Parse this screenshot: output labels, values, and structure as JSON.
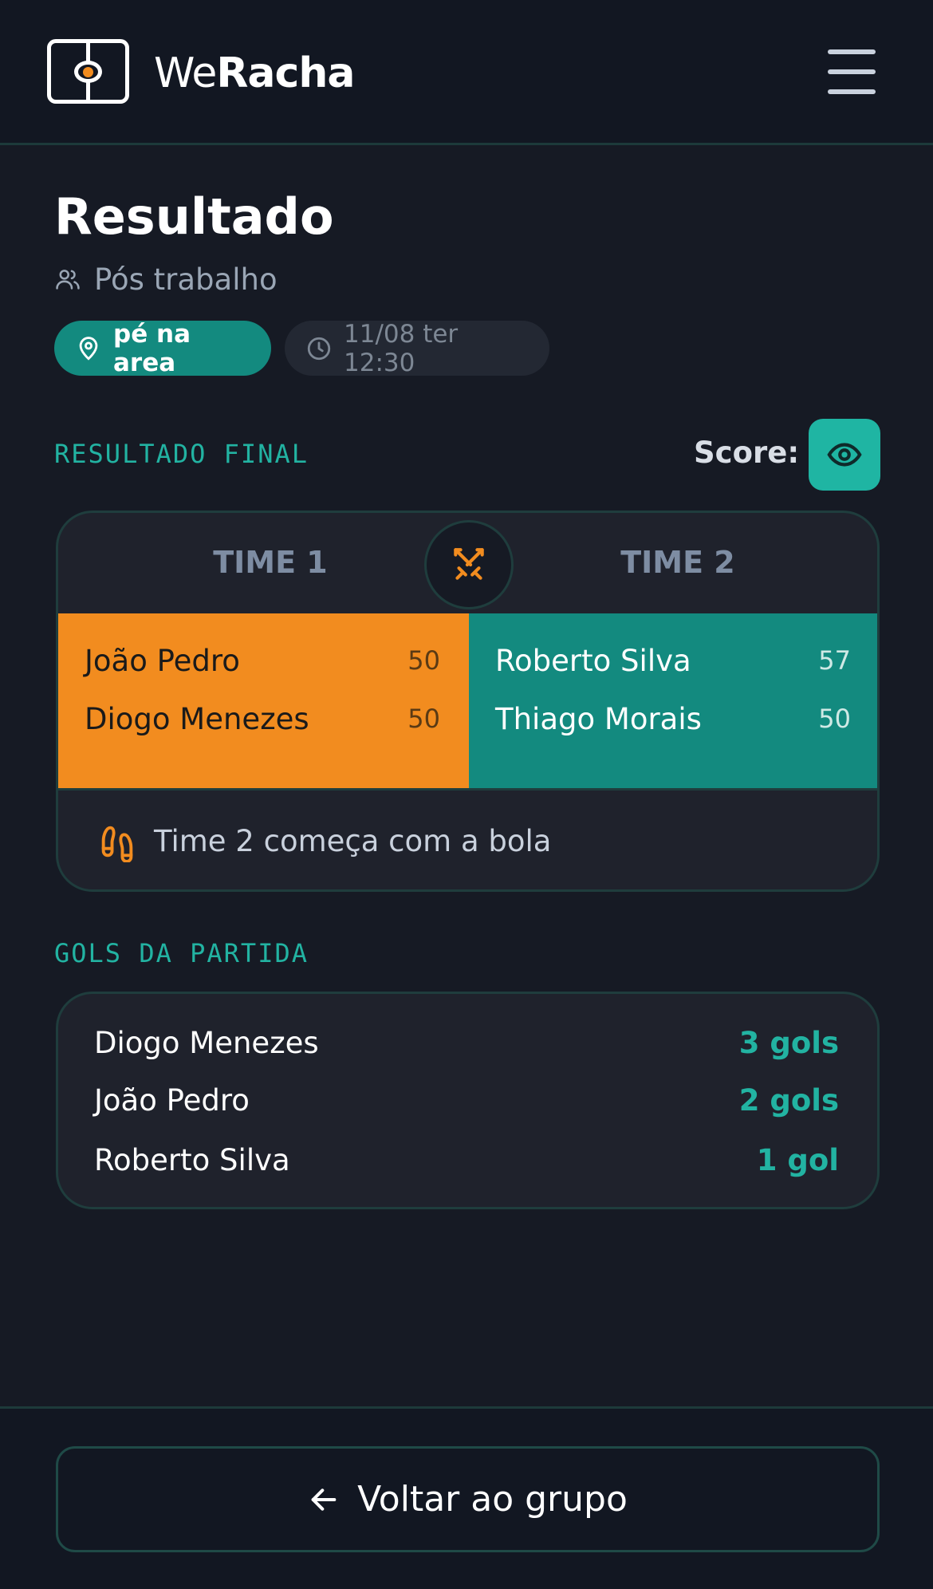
{
  "header": {
    "brand_light": "We",
    "brand_bold": "Racha"
  },
  "page": {
    "title": "Resultado",
    "group_name": "Pós trabalho",
    "location": "pé na area",
    "datetime": "11/08 ter 12:30"
  },
  "result": {
    "section_label": "RESULTADO FINAL",
    "score_label": "Score:",
    "team1": {
      "name": "TIME 1",
      "players": [
        {
          "name": "João Pedro",
          "score": "50"
        },
        {
          "name": "Diogo Menezes",
          "score": "50"
        }
      ]
    },
    "team2": {
      "name": "TIME 2",
      "players": [
        {
          "name": "Roberto Silva",
          "score": "57"
        },
        {
          "name": "Thiago Morais",
          "score": "50"
        }
      ]
    },
    "kickoff_text": "Time 2 começa com a bola"
  },
  "goals": {
    "section_label": "GOLS DA PARTIDA",
    "items": [
      {
        "name": "Diogo Menezes",
        "count": "3 gols"
      },
      {
        "name": "João Pedro",
        "count": "2 gols"
      },
      {
        "name": "Roberto Silva",
        "count": "1 gol"
      }
    ]
  },
  "footer": {
    "back_label": "Voltar ao grupo"
  },
  "colors": {
    "accent_teal": "#1fb5a3",
    "team1_orange": "#f28c1f",
    "team2_teal": "#138a7f",
    "background": "#161a24"
  }
}
